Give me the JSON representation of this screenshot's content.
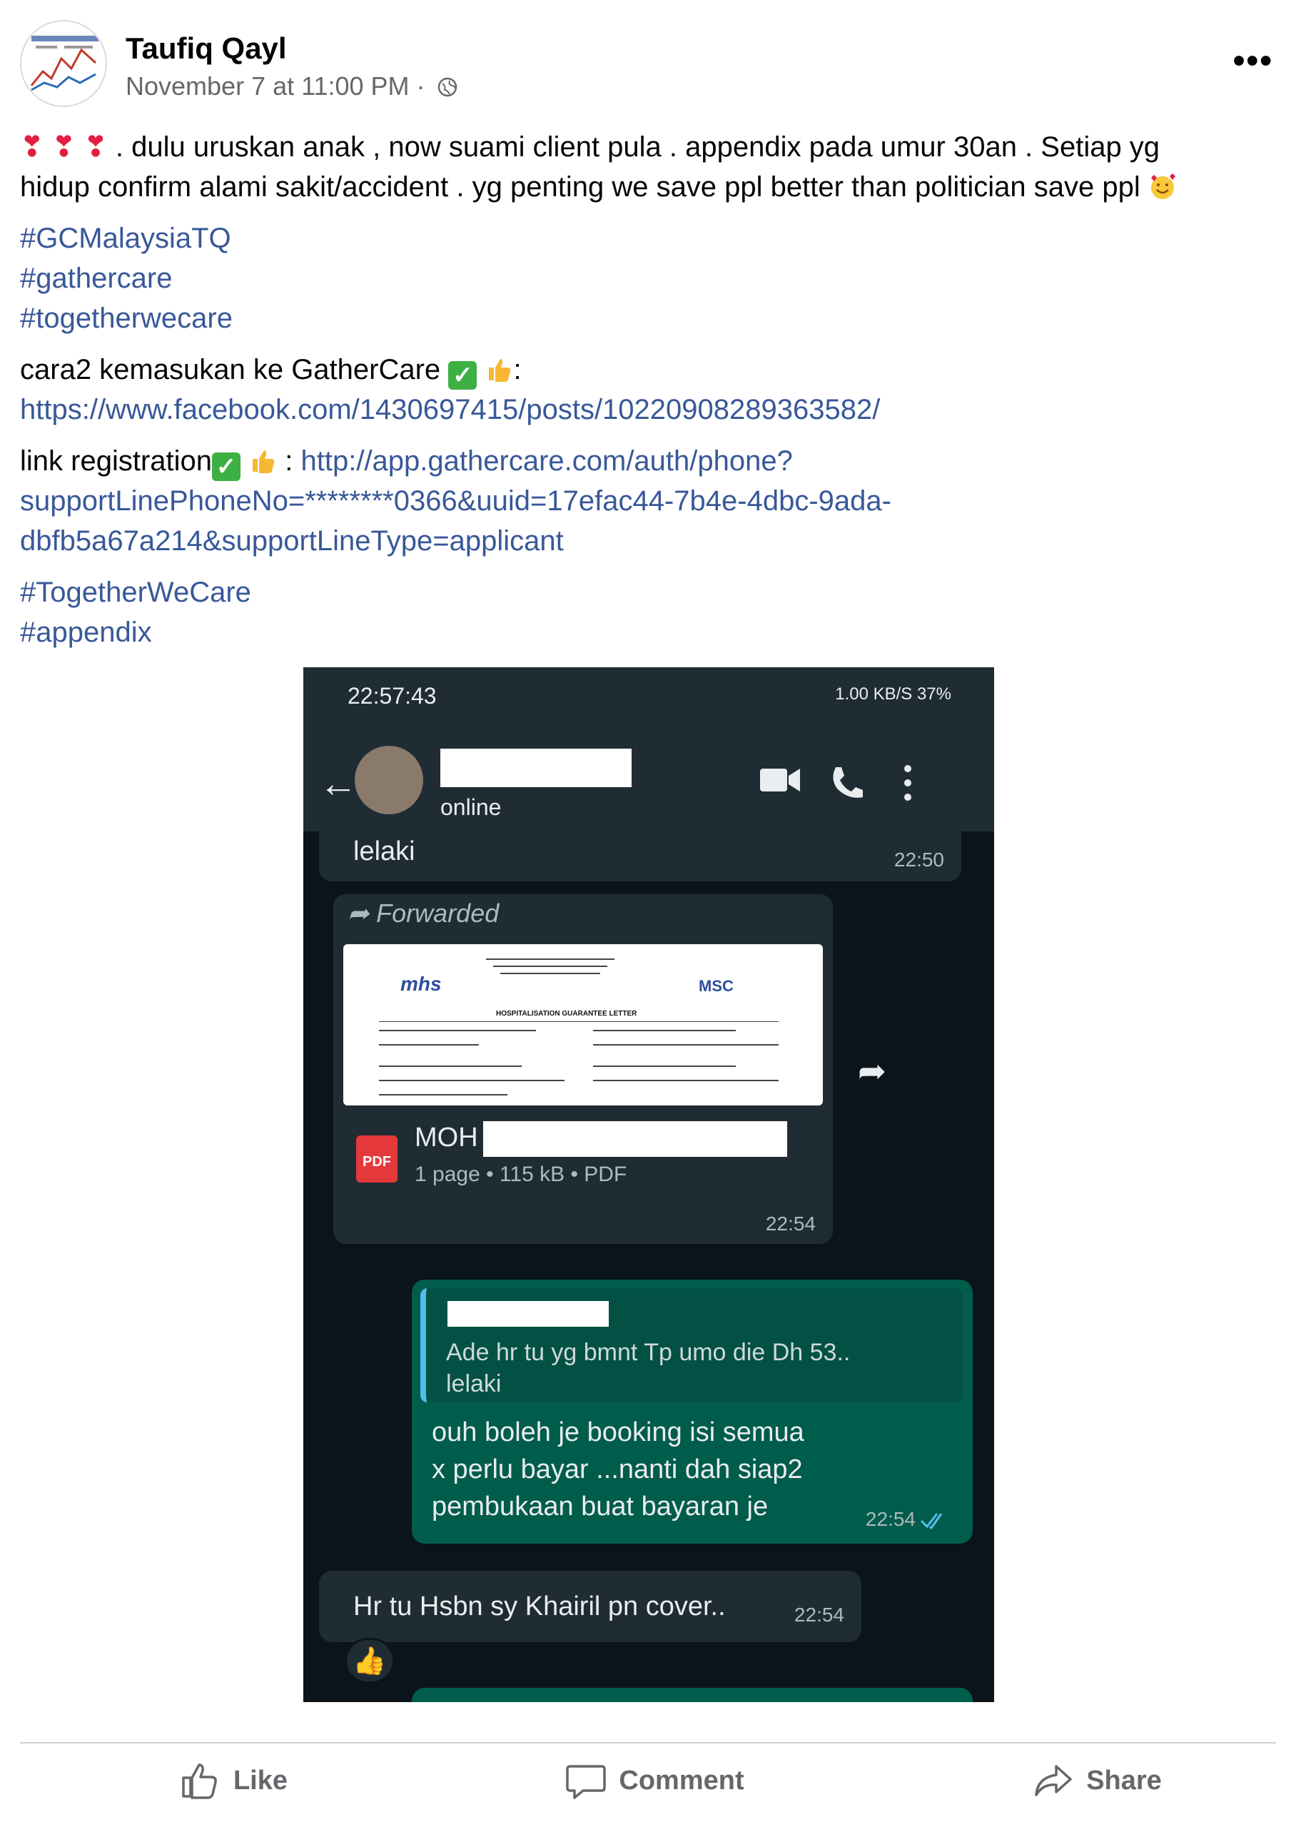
{
  "post": {
    "author": "Taufiq Qayl",
    "timestamp": "November 7 at 11:00 PM",
    "separator": "·",
    "more_label": "•••",
    "text_line1": ". dulu uruskan anak , now suami client pula . appendix pada umur 30an . Setiap yg",
    "text_line2": "hidup confirm alami sakit/accident . yg penting we save ppl better than politician save ppl",
    "hearts": "❣ ❣ ❣",
    "hashtags1": [
      "#GCMalaysiaTQ",
      "#gathercare",
      "#togetherwecare"
    ],
    "cara_text": "cara2 kemasukan ke GatherCare",
    "cara_link": "https://www.facebook.com/1430697415/posts/10220908289363582/",
    "reg_label": "link registration",
    "reg_link_1": "http://app.gathercare.com/auth/phone?",
    "reg_link_2": "supportLinePhoneNo=********0366&uuid=17efac44-7b4e-4dbc-9ada-",
    "reg_link_3": "dbfb5a67a214&supportLineType=applicant",
    "hashtags2": [
      "#TogetherWeCare",
      "#appendix"
    ]
  },
  "screenshot": {
    "status_time": "22:57:43",
    "status_right": "1.00 KB/S   37%",
    "contact_status": "online",
    "msg1_text": "lelaki",
    "msg1_time": "22:50",
    "fwd_label": "Forwarded",
    "doc_header": "HOSPITALISATION GUARANTEE LETTER",
    "doc_logo": "mhs",
    "doc_logo2": "MSC",
    "doc_name": "MOH",
    "doc_meta": "1 page • 115 kB • PDF",
    "doc_time": "22:54",
    "pdf_label": "PDF",
    "quote_text_1": "Ade hr tu yg bmnt Tp umo die Dh 53..",
    "quote_text_2": "lelaki",
    "reply_1": "ouh boleh je booking isi semua",
    "reply_2": "x perlu bayar ...nanti dah siap2",
    "reply_3": "pembukaan buat bayaran je",
    "reply_time": "22:54",
    "msg3_text": "Hr tu Hsbn sy Khairil pn cover..",
    "msg3_time": "22:54",
    "reaction": "👍"
  },
  "actions": {
    "like": "Like",
    "comment": "Comment",
    "share": "Share"
  },
  "colors": {
    "link": "#385898",
    "wa_bg": "#0b141a",
    "wa_in": "#202c33",
    "wa_out": "#005c4b"
  }
}
